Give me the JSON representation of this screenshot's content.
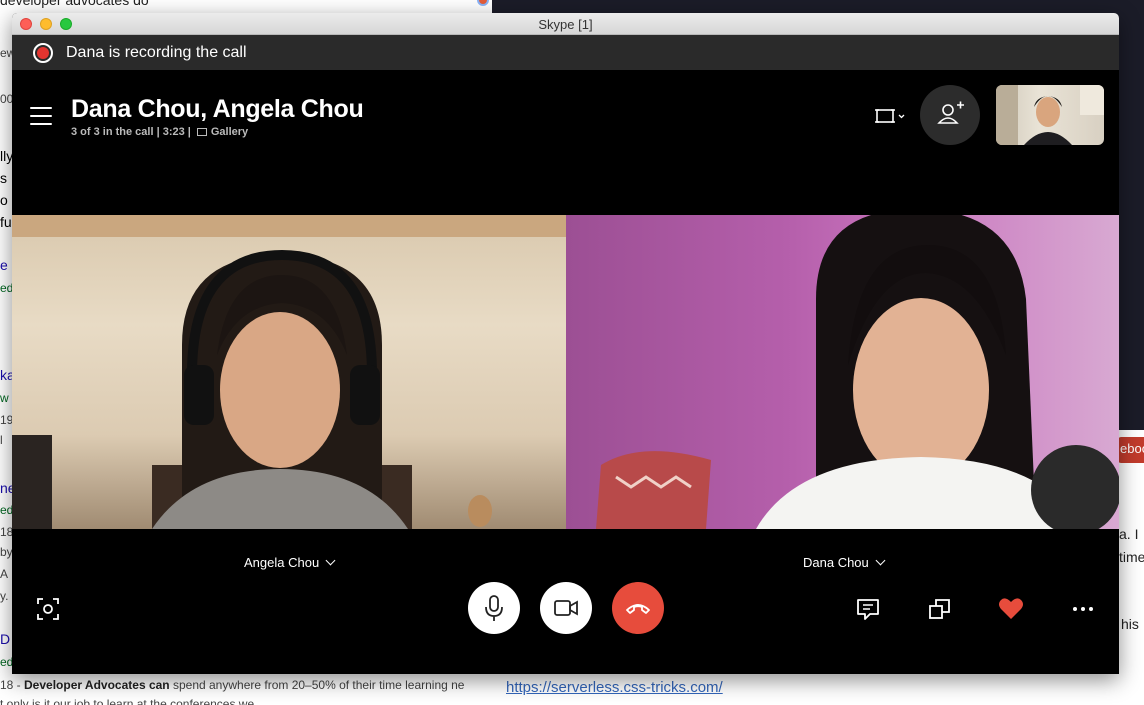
{
  "background": {
    "top_text": "developer advocates do",
    "left_fragments": [
      "ew",
      "00",
      "lly",
      "s",
      "o",
      "fu",
      "e",
      "ed",
      "ka",
      "w",
      "19",
      "l",
      "ne",
      "ed",
      "18",
      "by",
      "A",
      "y.",
      "D",
      "ed"
    ],
    "right_fragments": [
      "a. I",
      "time",
      "his"
    ],
    "red_badge": "eboo",
    "snippet_prefix": "18 - ",
    "snippet_bold": "Developer Advocates can",
    "snippet_rest": " spend anywhere from 20–50% of their time learning ne",
    "snippet_line2": "t only is it our job to learn at the conferences we",
    "link": "https://serverless.css-tricks.com/"
  },
  "window": {
    "title": "Skype [1]"
  },
  "recording": {
    "text": "Dana is recording the call"
  },
  "call": {
    "title": "Dana Chou, Angela Chou",
    "status": "3 of 3 in the call | 3:23  |",
    "view_mode": "Gallery"
  },
  "participants": [
    {
      "name": "Angela Chou"
    },
    {
      "name": "Dana Chou"
    }
  ],
  "icons": {
    "menu": "hamburger-menu-icon",
    "fit": "fit-to-screen-icon",
    "add_person": "add-person-icon",
    "snapshot": "snapshot-icon",
    "mic": "microphone-icon",
    "camera": "camera-icon",
    "end_call": "end-call-icon",
    "chat": "chat-icon",
    "switch": "switch-screens-icon",
    "react": "heart-icon",
    "more": "more-options-icon"
  },
  "colors": {
    "end_call": "#e74c3c",
    "heart": "#e74c3c",
    "recording_dot": "#e3342f",
    "window_bg": "#000000"
  }
}
